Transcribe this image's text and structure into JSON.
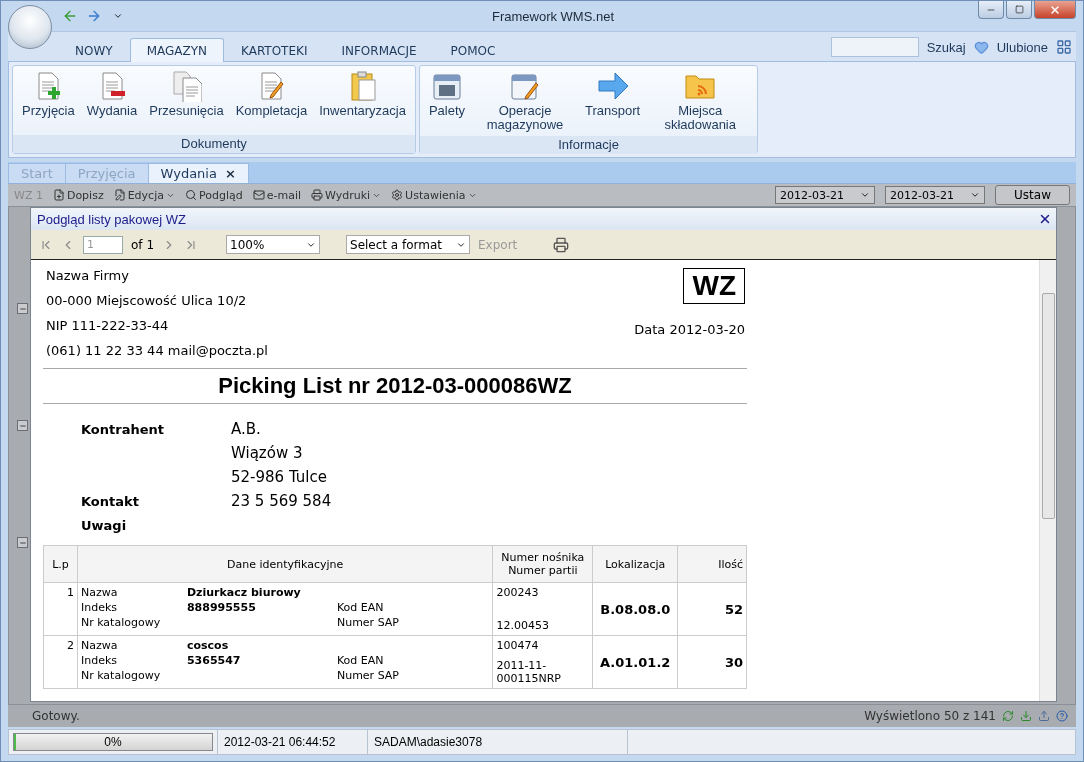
{
  "window": {
    "title": "Framework WMS.net"
  },
  "ribbon_tabs": [
    {
      "label": "NOWY",
      "selected": false
    },
    {
      "label": "MAGAZYN",
      "selected": true
    },
    {
      "label": "KARTOTEKI",
      "selected": false
    },
    {
      "label": "INFORMACJE",
      "selected": false
    },
    {
      "label": "POMOC",
      "selected": false
    }
  ],
  "search": {
    "button": "Szukaj"
  },
  "favorites": {
    "label": "Ulubione"
  },
  "ribbon_groups": [
    {
      "title": "Dokumenty",
      "items": [
        {
          "label": "Przyjęcia",
          "kind": "receipt"
        },
        {
          "label": "Wydania",
          "kind": "issue"
        },
        {
          "label": "Przesunięcia",
          "kind": "transfer"
        },
        {
          "label": "Kompletacja",
          "kind": "completion"
        },
        {
          "label": "Inwentaryzacja",
          "kind": "inventory"
        }
      ]
    },
    {
      "title": "Informacje",
      "items": [
        {
          "label": "Palety",
          "kind": "pallets"
        },
        {
          "label": "Operacje magazynowe",
          "kind": "operations"
        },
        {
          "label": "Transport",
          "kind": "transport"
        },
        {
          "label": "Miejsca składowania",
          "kind": "locations"
        }
      ]
    }
  ],
  "document_tabs": [
    {
      "label": "Start",
      "selected": false
    },
    {
      "label": "Przyjęcia",
      "selected": false
    },
    {
      "label": "Wydania",
      "selected": true,
      "close": "×"
    }
  ],
  "toolbar": {
    "label": "WZ 1",
    "items": [
      {
        "label": "Dopisz",
        "dropdown": false
      },
      {
        "label": "Edycja",
        "dropdown": true
      },
      {
        "label": "Podgląd",
        "dropdown": false
      },
      {
        "label": "e-mail",
        "dropdown": false
      },
      {
        "label": "Wydruki",
        "dropdown": true
      },
      {
        "label": "Ustawienia",
        "dropdown": true
      }
    ],
    "date_from": "2012-03-21",
    "date_to": "2012-03-21",
    "apply": "Ustaw"
  },
  "dialog": {
    "title": "Podgląd listy pakowej WZ",
    "page": "1",
    "page_count": "of 1",
    "zoom": "100%",
    "format": "Select a format",
    "export": {
      "label": "Export",
      "disabled": true
    }
  },
  "report": {
    "company": [
      "Nazwa Firmy",
      "00-000 Miejscowość Ulica 10/2",
      "NIP 111-222-33-44",
      "(061) 11 22 33 44 mail@poczta.pl"
    ],
    "doc_type": "WZ",
    "date": "Data 2012-03-20",
    "title": "Picking List nr 2012-03-000086WZ",
    "contractor": [
      {
        "label": "Kontrahent",
        "lines": [
          "A.B.",
          "Wiązów 3",
          "52-986 Tulce"
        ]
      },
      {
        "label": "Kontakt",
        "lines": [
          "23 5 569 584"
        ]
      },
      {
        "label": "Uwagi"
      }
    ],
    "columns": [
      "L.p",
      "Dane identyfikacyjne",
      "Numer nośnika Numer partii",
      "Lokalizacja",
      "Ilość"
    ],
    "rows": [
      {
        "lp": "1",
        "name_label": "Nazwa",
        "name": "Dziurkacz biurowy",
        "index_label": "Indeks",
        "index": "888995555",
        "catalog_label": "Nr katalogowy",
        "ean_label": "Kod EAN",
        "sap_label": "Numer SAP",
        "carrier": "200243",
        "batch": "12.00453",
        "location": "B.08.08.0",
        "quantity": "52"
      },
      {
        "lp": "2",
        "name_label": "Nazwa",
        "name": "coscos",
        "index_label": "Indeks",
        "index": "5365547",
        "catalog_label": "Nr katalogowy",
        "ean_label": "Kod EAN",
        "sap_label": "Numer SAP",
        "carrier": "100474",
        "batch": "2011-11-000115NRP",
        "location": "A.01.01.2",
        "quantity": "30"
      }
    ]
  },
  "status": {
    "text": "Gotowy.",
    "count": "Wyświetlono 50 z 141"
  },
  "bottom_bar": {
    "progress": {
      "label": "0%",
      "level": 0
    },
    "datetime": "2012-03-21 06:44:52",
    "user": "SADAM\\adasie3078"
  }
}
